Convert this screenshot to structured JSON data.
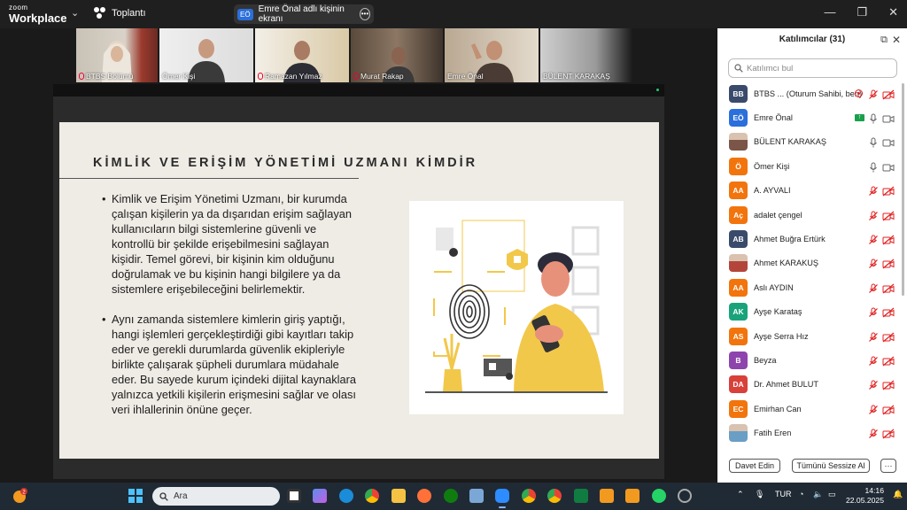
{
  "app": {
    "brand_small": "zoom",
    "brand_large": "Workplace",
    "meeting_label": "Toplantı",
    "share_initials": "EÖ",
    "share_label": "Emre Önal adlı kişinin ekranı",
    "window_controls": [
      "—",
      "❐",
      "✕"
    ]
  },
  "video_strip": [
    {
      "name": "BTBS Bölümü",
      "muted": true
    },
    {
      "name": "Ömer Kişi",
      "muted": false
    },
    {
      "name": "Ramazan Yılmaz",
      "muted": true
    },
    {
      "name": "Murat Rakap",
      "muted": true
    },
    {
      "name": "Emre Önal",
      "muted": false,
      "active": true
    },
    {
      "name": "BÜLENT KARAKAŞ",
      "muted": false
    }
  ],
  "slide": {
    "title": "KİMLİK VE ERİŞİM YÖNETİMİ UZMANI KİMDİR",
    "bullets": [
      "Kimlik ve Erişim Yönetimi Uzmanı, bir kurumda çalışan kişilerin ya da dışarıdan erişim sağlayan kullanıcıların bilgi sistemlerine güvenli ve kontrollü bir şekilde erişebilmesini sağlayan kişidir. Temel görevi, bir kişinin kim olduğunu doğrulamak ve bu kişinin hangi bilgilere ya da sistemlere erişebileceğini belirlemektir.",
      "Aynı zamanda sistemlere kimlerin giriş yaptığı, hangi işlemleri gerçekleştirdiği gibi kayıtları takip eder ve gerekli durumlarda güvenlik ekipleriyle birlikte çalışarak şüpheli durumlara müdahale eder. Bu sayede kurum içindeki dijital kaynaklara yalnızca yetkili kişilerin erişmesini sağlar ve olası veri ihlallerinin önüne geçer."
    ]
  },
  "participants": {
    "title": "Katılımcılar (31)",
    "search_placeholder": "Katılımcı bul",
    "items": [
      {
        "initials": "BB",
        "name": "BTBS ... (Oturum Sahibi, ben)",
        "color": "#3a4a6b",
        "mic": "muted",
        "video": "off",
        "extra": "record"
      },
      {
        "initials": "EÖ",
        "name": "Emre Önal",
        "color": "#2a6fdb",
        "mic": "on",
        "video": "on",
        "extra": "share"
      },
      {
        "initials": "",
        "name": "BÜLENT KARAKAŞ",
        "color": "#7a5548",
        "mic": "on",
        "video": "on",
        "photo": true
      },
      {
        "initials": "Ö",
        "name": "Ömer Kişi",
        "color": "#f2740d",
        "mic": "on",
        "video": "on"
      },
      {
        "initials": "AA",
        "name": "A. AYVALI",
        "color": "#f2740d",
        "mic": "muted",
        "video": "off"
      },
      {
        "initials": "Aç",
        "name": "adalet çengel",
        "color": "#f2740d",
        "mic": "muted",
        "video": "off"
      },
      {
        "initials": "AB",
        "name": "Ahmet Buğra Ertürk",
        "color": "#3a4a6b",
        "mic": "muted",
        "video": "off"
      },
      {
        "initials": "",
        "name": "Ahmet KARAKUŞ",
        "color": "#b4453b",
        "mic": "muted",
        "video": "off",
        "photo": true
      },
      {
        "initials": "AA",
        "name": "Aslı AYDIN",
        "color": "#f2740d",
        "mic": "muted",
        "video": "off"
      },
      {
        "initials": "AK",
        "name": "Ayşe Karataş",
        "color": "#1aa37a",
        "mic": "muted",
        "video": "off"
      },
      {
        "initials": "AS",
        "name": "Ayşe Serra Hız",
        "color": "#f2740d",
        "mic": "muted",
        "video": "off"
      },
      {
        "initials": "B",
        "name": "Beyza",
        "color": "#8e44ad",
        "mic": "muted",
        "video": "off"
      },
      {
        "initials": "DA",
        "name": "Dr. Ahmet BULUT",
        "color": "#d8403a",
        "mic": "muted",
        "video": "off"
      },
      {
        "initials": "EC",
        "name": "Emirhan Can",
        "color": "#f2740d",
        "mic": "muted",
        "video": "off"
      },
      {
        "initials": "",
        "name": "Fatih Eren",
        "color": "#6a9ec4",
        "mic": "muted",
        "video": "off",
        "photo": true
      }
    ],
    "invite_label": "Davet Edin",
    "mute_all_label": "Tümünü Sessize Al",
    "more_label": "···"
  },
  "taskbar": {
    "weather_badge": "2",
    "search_label": "Ara",
    "lang": "TUR",
    "time": "14:16",
    "date": "22.05.2025",
    "badges": {
      "chrome1": "6",
      "chrome2": "8",
      "whatsapp": "2"
    }
  },
  "colors": {
    "accent": "#2a6fdb",
    "active_speaker": "#28c76f",
    "muted": "#e02020"
  }
}
